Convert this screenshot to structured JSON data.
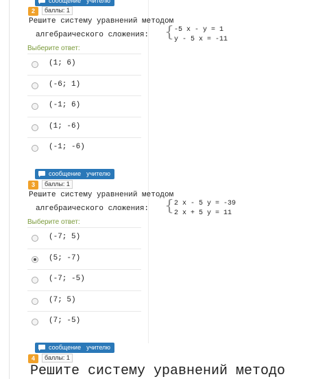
{
  "message_button": {
    "word1": "сообщение",
    "word2": "учителю"
  },
  "answer_prompt": "Выберите ответ:",
  "q2": {
    "number": "2",
    "points": "баллы: 1",
    "text_line1": "Решите систему уравнений методом",
    "text_line2": "алгебраического сложения:",
    "eq1": "-5 x - y = 1",
    "eq2": "y - 5 x = -11",
    "options": [
      "(1; 6)",
      "(-6; 1)",
      "(-1; 6)",
      "(1; -6)",
      "(-1; -6)"
    ]
  },
  "q3": {
    "number": "3",
    "points": "баллы: 1",
    "text_line1": "Решите систему уравнений методом",
    "text_line2": "алгебраического сложения:",
    "eq1": "2 x - 5 y = -39",
    "eq2": "2 x + 5 y = 11",
    "options": [
      "(-7; 5)",
      "(5; -7)",
      "(-7; -5)",
      "(7; 5)",
      "(7; -5)"
    ],
    "selected_index": 1
  },
  "q4": {
    "number": "4",
    "points": "баллы: 1",
    "text_line1": "Решите систему уравнений методо"
  }
}
